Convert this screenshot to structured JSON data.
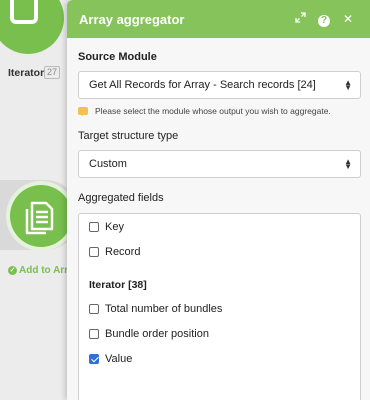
{
  "canvas": {
    "iterator_label": "Iterator",
    "iterator_badge": "27",
    "add_label": "Add to Arra"
  },
  "dialog": {
    "title": "Array aggregator",
    "header_icons": [
      "expand-icon",
      "help-icon",
      "close-icon"
    ],
    "source_module": {
      "label": "Source Module",
      "value": "Get All Records for Array - Search records [24]",
      "hint": "Please select the module whose output you wish to aggregate."
    },
    "target_structure": {
      "label": "Target structure type",
      "value": "Custom"
    },
    "aggregated_fields": {
      "label": "Aggregated fields",
      "items_top": [
        {
          "label": "Key",
          "checked": false
        },
        {
          "label": "Record",
          "checked": false
        }
      ],
      "group_title": "Iterator [38]",
      "items_group": [
        {
          "label": "Total number of bundles",
          "checked": false
        },
        {
          "label": "Bundle order position",
          "checked": false
        },
        {
          "label": "Value",
          "checked": true
        }
      ]
    }
  },
  "colors": {
    "header_green": "#86c35b",
    "module_green": "#79bf4e",
    "checkbox_blue": "#2f6fd6",
    "hint_yellow": "#f1c34c"
  }
}
